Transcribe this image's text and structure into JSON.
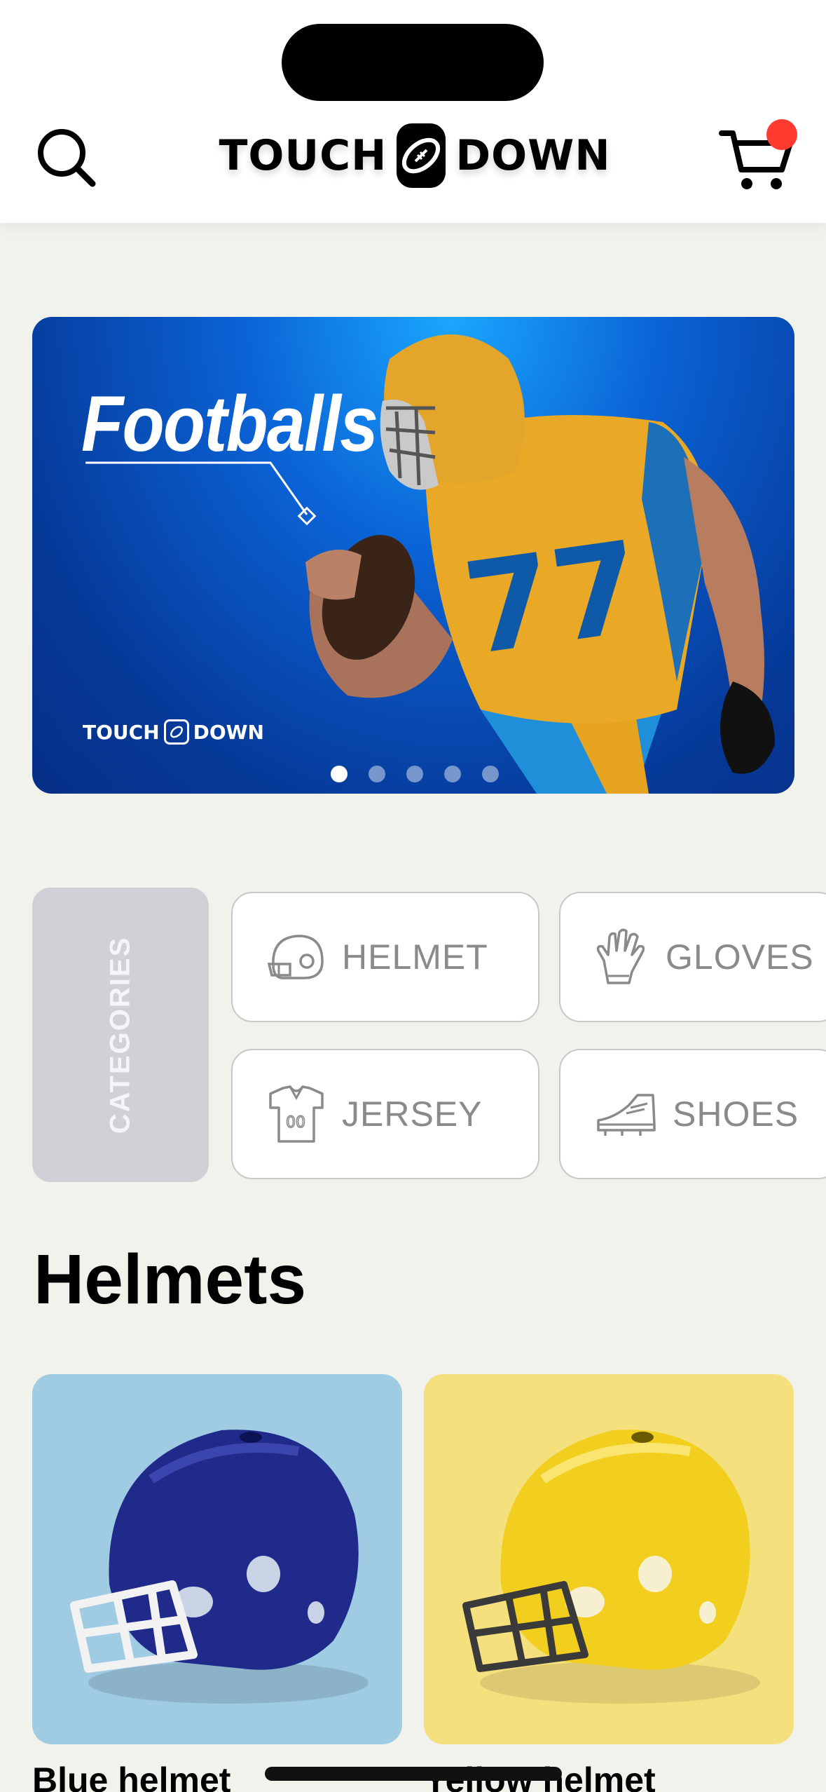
{
  "header": {
    "logo_left": "TOUCH",
    "logo_right": "DOWN",
    "search_icon": "search-icon",
    "cart_icon": "cart-icon",
    "cart_badge_color": "#ff3b30"
  },
  "banner": {
    "title": "Footballs",
    "logo_left": "TOUCH",
    "logo_right": "DOWN",
    "slide_count": 5,
    "active_slide": 1
  },
  "categories": {
    "label": "CATEGORIES",
    "items": [
      {
        "label": "HELMET",
        "icon": "helmet-icon"
      },
      {
        "label": "GLOVES",
        "icon": "glove-icon"
      },
      {
        "label": "JERSEY",
        "icon": "jersey-icon"
      },
      {
        "label": "SHOES",
        "icon": "shoe-icon"
      }
    ]
  },
  "section": {
    "title": "Helmets"
  },
  "products": [
    {
      "name": "Blue helmet",
      "bg": "#9fcbe3",
      "helmet_color": "#1f2a8a"
    },
    {
      "name": "Yellow helmet",
      "bg": "#f5e07e",
      "helmet_color": "#f2cf1e"
    }
  ]
}
